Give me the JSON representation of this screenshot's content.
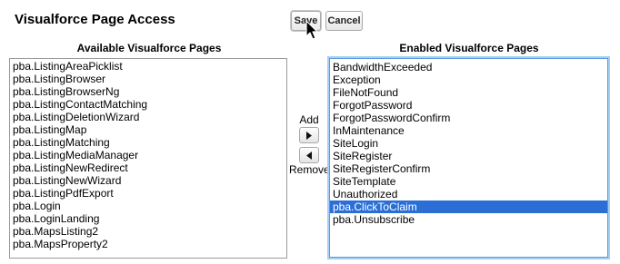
{
  "header": {
    "title": "Visualforce Page Access",
    "save_label": "Save",
    "cancel_label": "Cancel"
  },
  "available": {
    "label": "Available Visualforce Pages",
    "items": [
      "pba.ListingAreaPicklist",
      "pba.ListingBrowser",
      "pba.ListingBrowserNg",
      "pba.ListingContactMatching",
      "pba.ListingDeletionWizard",
      "pba.ListingMap",
      "pba.ListingMatching",
      "pba.ListingMediaManager",
      "pba.ListingNewRedirect",
      "pba.ListingNewWizard",
      "pba.ListingPdfExport",
      "pba.Login",
      "pba.LoginLanding",
      "pba.MapsListing2",
      "pba.MapsProperty2"
    ]
  },
  "controls": {
    "add_label": "Add",
    "remove_label": "Remove",
    "add_icon": "right-arrow-icon",
    "remove_icon": "left-arrow-icon"
  },
  "enabled": {
    "label": "Enabled Visualforce Pages",
    "selected_index": 11,
    "items": [
      "BandwidthExceeded",
      "Exception",
      "FileNotFound",
      "ForgotPassword",
      "ForgotPasswordConfirm",
      "InMaintenance",
      "SiteLogin",
      "SiteRegister",
      "SiteRegisterConfirm",
      "SiteTemplate",
      "Unauthorized",
      "pba.ClickToClaim",
      "pba.Unsubscribe"
    ]
  },
  "colors": {
    "selection": "#2b6fd6",
    "focus_ring": "#5b9bdc"
  }
}
